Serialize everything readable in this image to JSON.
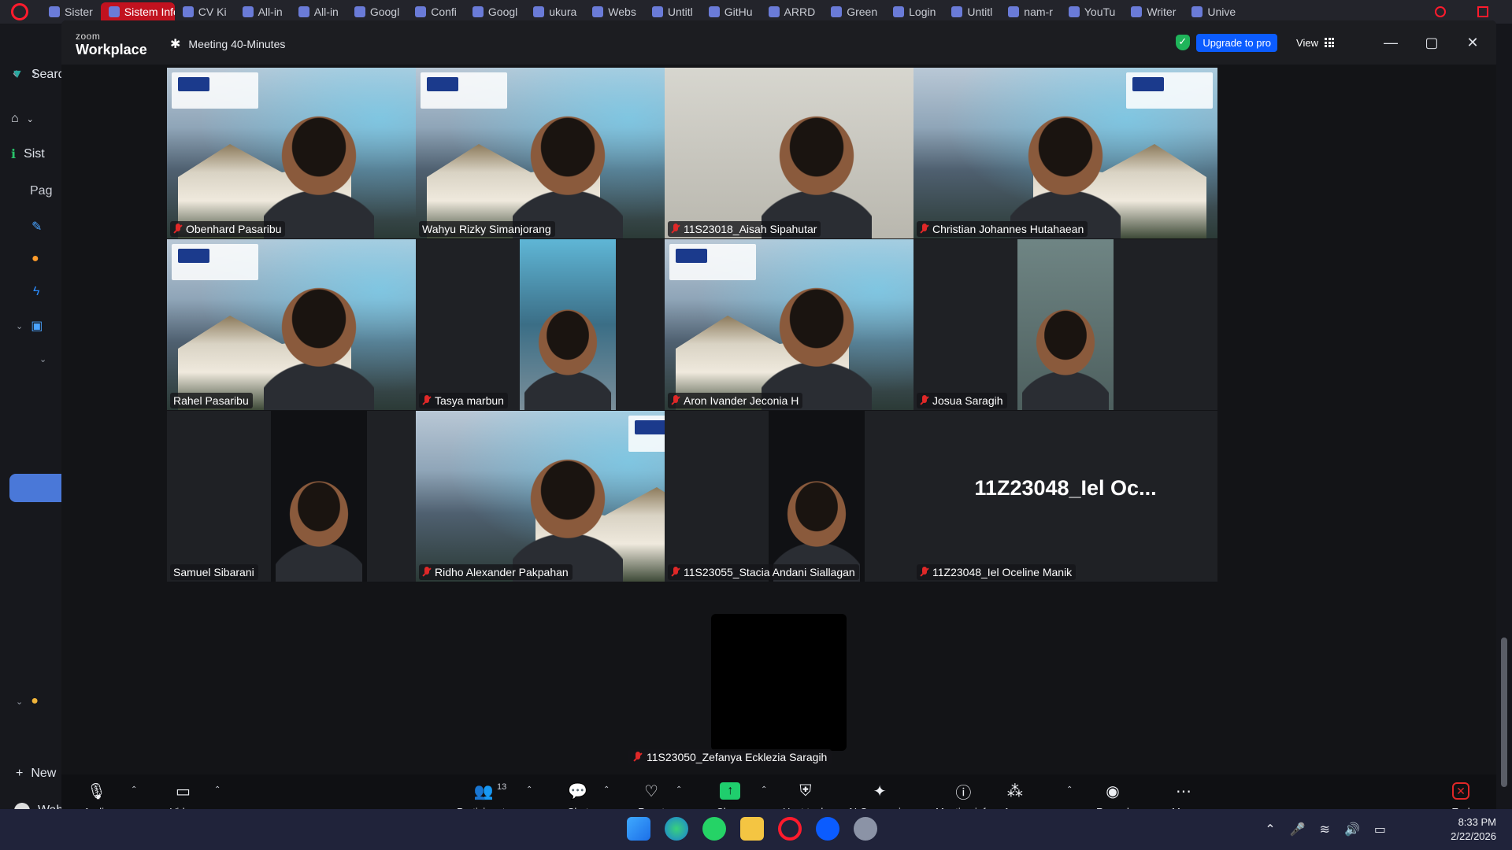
{
  "browser": {
    "tabs": [
      {
        "label": "Sister",
        "active": false
      },
      {
        "label": "Sistem Inform",
        "active": true
      },
      {
        "label": "CV Ki",
        "active": false
      },
      {
        "label": "All-in",
        "active": false
      },
      {
        "label": "All-in",
        "active": false
      },
      {
        "label": "Googl",
        "active": false
      },
      {
        "label": "Confi",
        "active": false
      },
      {
        "label": "Googl",
        "active": false
      },
      {
        "label": "ukura",
        "active": false
      },
      {
        "label": "Webs",
        "active": false
      },
      {
        "label": "Untitl",
        "active": false
      },
      {
        "label": "GitHu",
        "active": false
      },
      {
        "label": "ARRD",
        "active": false
      },
      {
        "label": "Green",
        "active": false
      },
      {
        "label": "Login",
        "active": false
      },
      {
        "label": "Untitl",
        "active": false
      },
      {
        "label": "nam-r",
        "active": false
      },
      {
        "label": "YouTu",
        "active": false
      },
      {
        "label": "Writer",
        "active": false
      },
      {
        "label": "Unive",
        "active": false
      }
    ],
    "search_label": "Searc",
    "sidebar": {
      "section": "Sist",
      "page": "Pag",
      "new_label": "New",
      "user_label": "Wah"
    }
  },
  "zoom": {
    "brand_small": "zoom",
    "brand_large": "Workplace",
    "meeting_title": "Meeting 40-Minutes",
    "upgrade_label": "Upgrade to pro",
    "view_label": "View",
    "participants": [
      {
        "name": "Obenhard Pasaribu",
        "muted": true,
        "bg": "campus",
        "speaking": false
      },
      {
        "name": "Wahyu Rizky Simanjorang",
        "muted": false,
        "bg": "campus",
        "speaking": true
      },
      {
        "name": "11S23018_Aisah Sipahutar",
        "muted": true,
        "bg": "room",
        "speaking": false
      },
      {
        "name": "Christian Johannes Hutahaean",
        "muted": true,
        "bg": "campus-mirror",
        "speaking": false
      },
      {
        "name": "Rahel Pasaribu",
        "muted": false,
        "bg": "campus",
        "speaking": false
      },
      {
        "name": "Tasya marbun",
        "muted": true,
        "bg": "inset-campus",
        "speaking": false
      },
      {
        "name": "Aron Ivander Jeconia H",
        "muted": true,
        "bg": "campus",
        "speaking": false
      },
      {
        "name": "Josua Saragih",
        "muted": true,
        "bg": "inset-room",
        "speaking": false
      },
      {
        "name": "Samuel Sibarani",
        "muted": false,
        "bg": "inset-dark",
        "speaking": false
      },
      {
        "name": "Ridho Alexander Pakpahan",
        "muted": true,
        "bg": "campus-mirror",
        "speaking": false
      },
      {
        "name": "11S23055_Stacia Andani Siallagan",
        "muted": true,
        "bg": "inset-dark",
        "speaking": false
      },
      {
        "name": "11Z23048_Iel Oceline Manik",
        "muted": true,
        "bg": "name-only",
        "speaking": false,
        "display_text": "11Z23048_Iel  Oc..."
      }
    ],
    "solo_participant": {
      "name": "11S23050_Zefanya Ecklezia Saragih",
      "muted": true
    },
    "toolbar": {
      "audio": "Audio",
      "video": "Video",
      "participants": "Participants",
      "participants_count": "13",
      "chat": "Chat",
      "react": "React",
      "share": "Share",
      "host_tools": "Host tools",
      "ai_companion": "AI Companion",
      "meeting_info": "Meeting info",
      "apps": "Apps",
      "record": "Record",
      "more": "More",
      "end": "End"
    }
  },
  "taskbar": {
    "time": "8:33 PM",
    "date": "2/22/2026"
  },
  "colors": {
    "speaking_border": "#23d160",
    "upgrade_bg": "#0b5cff",
    "share_green": "#1fce6d",
    "mute_red": "#e02828",
    "browser_accent": "#c1121f"
  }
}
